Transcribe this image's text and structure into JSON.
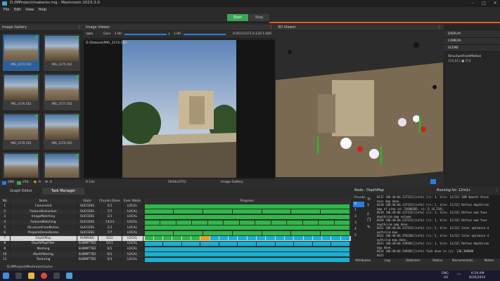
{
  "window": {
    "title": "D:/MProject/makarov.mg - Meshroom 2023.3.0"
  },
  "menu": [
    "File",
    "Edit",
    "View",
    "Help"
  ],
  "modes": {
    "start": "Start",
    "stop": "Stop"
  },
  "gallery": {
    "title": "Image Gallery",
    "thumbs": [
      "IMG_3174.CK2",
      "IMG_3175.CK2",
      "IMG_3176.CK2",
      "IMG_3177.CK2",
      "IMG_3178.CK2",
      "IMG_3179.CK2",
      "",
      ""
    ],
    "count_a": "289",
    "count_b": "254",
    "count_c": "0",
    "count_d": "6"
  },
  "image_viewer": {
    "title": "Image Viewer",
    "channel": "rgba",
    "gain_label": "Gain",
    "gain_value": "1.00",
    "gamma_label": "γ",
    "gamma_value": "1.00",
    "pixel_values": [
      "0.053",
      "0.071",
      "0.120",
      "1.000"
    ],
    "path": "D:/Dataset/IMG_3174.CK2",
    "zoom": "0.13x",
    "resolution": "5634x3752",
    "source": "Image Gallery"
  },
  "viewer3d": {
    "title": "3D Viewer"
  },
  "scene": {
    "items": [
      "DISPLAY",
      "CAMERA",
      "SCENE"
    ],
    "node_name": "StructureFromMotion",
    "node_counts": "150,811 ■ 254"
  },
  "bottom_tabs": [
    "Graph Editor",
    "Task Manager"
  ],
  "task_table": {
    "headers": [
      "Nb",
      "Node",
      "State",
      "Chunks Done",
      "Exec Mode",
      "Progress"
    ],
    "rows": [
      [
        "1",
        "CameraInit",
        "SUCCESS",
        "1/1",
        "LOCAL"
      ],
      [
        "2",
        "FeatureExtraction",
        "SUCCESS",
        "7/7",
        "LOCAL"
      ],
      [
        "3",
        "ImageMatching",
        "SUCCESS",
        "1/1",
        "LOCAL"
      ],
      [
        "4",
        "FeatureMatching",
        "SUCCESS",
        "13/13",
        "LOCAL"
      ],
      [
        "5",
        "StructureFromMotion",
        "SUCCESS",
        "1/1",
        "LOCAL"
      ],
      [
        "6",
        "PrepareDenseScene",
        "SUCCESS",
        "7/7",
        "LOCAL"
      ],
      [
        "7",
        "DepthMap",
        "RUNNING",
        "6/22",
        "LOCAL"
      ],
      [
        "8",
        "DepthMapFilter",
        "SUBMITTED",
        "0/11",
        "LOCAL"
      ],
      [
        "9",
        "Meshing",
        "SUBMITTED",
        "0/1",
        "LOCAL"
      ],
      [
        "10",
        "MeshFiltering",
        "SUBMITTED",
        "0/1",
        "LOCAL"
      ],
      [
        "11",
        "Texturing",
        "SUBMITTED",
        "0/1",
        "LOCAL"
      ]
    ],
    "progress": [
      1,
      1,
      1,
      1,
      1,
      1,
      0.27,
      0,
      0,
      0,
      0
    ]
  },
  "colors": {
    "success": "#2fb84a",
    "running": "#2fb84a",
    "submitted": "#1ab0d0",
    "current": "#e8a020",
    "accent": "#3aa655"
  },
  "node_panel": {
    "title": "Node - DepthMap",
    "running": "Running for: 12m1s",
    "chunks_label": "Chunks",
    "chunks": [
      "0",
      "1",
      "2",
      "3",
      "4",
      "5"
    ],
    "log": [
      "6617  [06:48:04.237153][info] [rc: 3, tile: 12/12] SGM Smooth thick",
      "          ness map done.",
      "6618  [06:48:04.237153][info] [rc: 1, tile: 12/12] Refine depth/sim",
      "          map of view id: 53690205, rc: 6 (6 254).",
      "6619  [06:48:04.237153][info] [rc: 1, tile: 12/12] Refine and fuse",
      "          depth/sim map volume.",
      "6620  [06:48:04.237153][info] [rc: 1, tile: 12/12] Refine and fuse",
      "          depth/sim map done.",
      "6621  [06:48:04.237153][info] [rc: 5, tile: 12/12] Color optimize d",
      "          epth/sim map.",
      "6622  [06:48:04.259230][info] [rc: 5, tile: 12/12] Color optimize d",
      "          epth/sim map done.",
      "6623  [06:48:04.549301][info] [rc: 1, tile: 12/12] Refine depth/sim",
      "          map done.",
      "6624  [06:48:04.549301][info] Task done in (s): 136.389000",
      "6625"
    ],
    "tabs": [
      "Attributes",
      "Log",
      "Statistics",
      "Status",
      "Documentati...",
      "Notes"
    ]
  },
  "path_bar": "D:/MProject/MeshroomCache",
  "taskbar": {
    "time": "6:59 AM",
    "date": "8/26/2024",
    "lang_a": "ENG",
    "lang_b": "US"
  }
}
